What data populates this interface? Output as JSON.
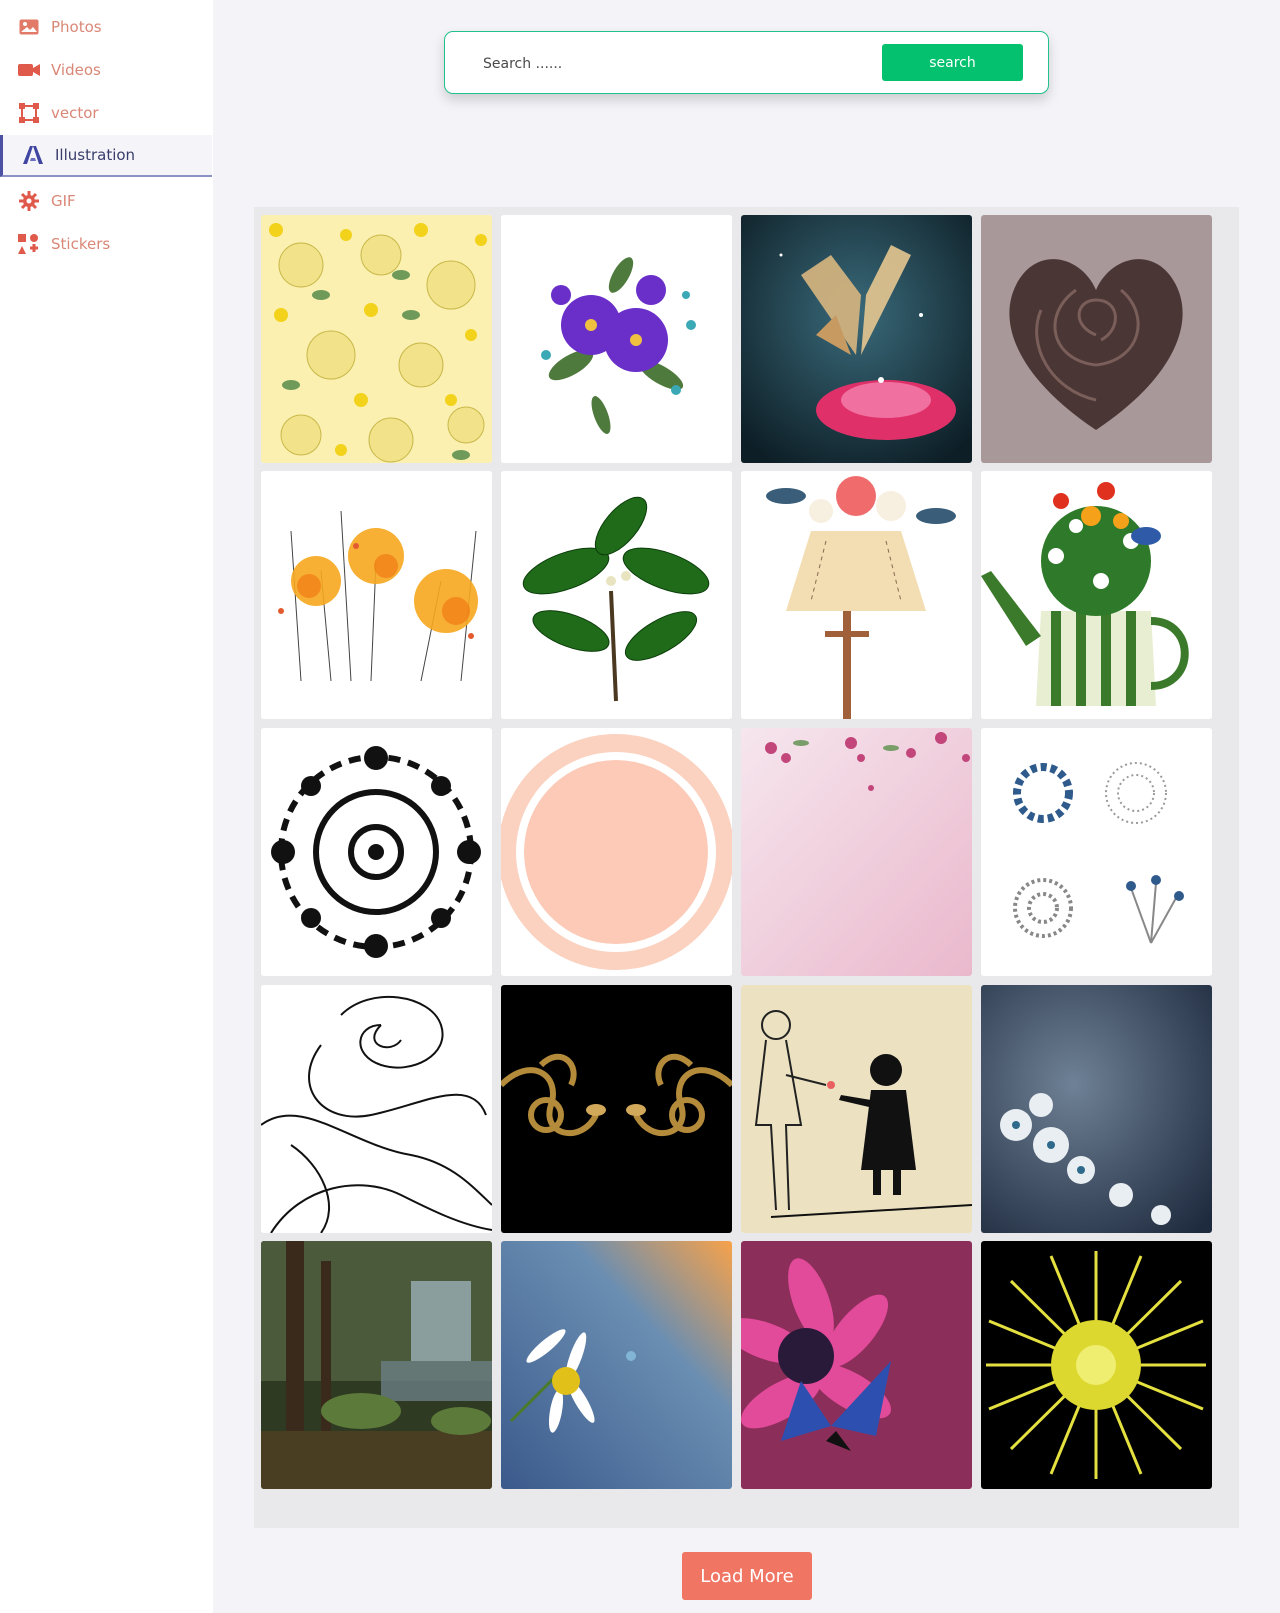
{
  "sidebar": {
    "items": [
      {
        "label": "Photos",
        "icon": "image-icon"
      },
      {
        "label": "Videos",
        "icon": "video-camera-icon"
      },
      {
        "label": "vector",
        "icon": "vector-path-icon"
      },
      {
        "label": "Illustration",
        "icon": "adobe-illustration-icon",
        "active": true
      },
      {
        "label": "GIF",
        "icon": "gear-icon"
      },
      {
        "label": "Stickers",
        "icon": "sticker-icon"
      }
    ]
  },
  "search": {
    "placeholder": "Search ......",
    "button_label": "search"
  },
  "gallery": {
    "images": [
      "yellow-floral-pattern",
      "purple-flower-bouquet",
      "butterfly-on-pink-flower",
      "dark-rose-heart",
      "orange-watercolor-flowers",
      "green-leaf-branch",
      "floral-lamp",
      "flowers-in-watering-can",
      "black-mandala",
      "peach-lace-doily",
      "pink-blossom-paper",
      "blue-and-silver-stickers",
      "rose-line-drawing",
      "gold-ornament-on-black",
      "boy-giving-flower-to-girl",
      "white-flowers-on-blue-texture",
      "forest-waterfall",
      "daisy-on-blue-gradient",
      "butterfly-on-magenta-flower",
      "yellow-starburst-on-black"
    ]
  },
  "load_more_label": "Load More",
  "colors": {
    "sidebar_text": "#d98776",
    "active_accent": "#4b50a5",
    "search_button": "#04c16f",
    "search_border": "#21c18b",
    "load_more": "#f07563"
  }
}
